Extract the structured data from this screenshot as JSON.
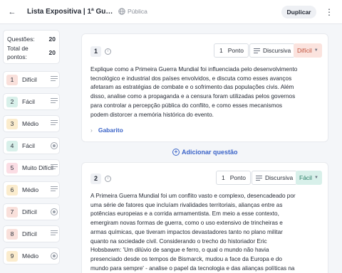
{
  "header": {
    "title": "Lista Expositiva | 1ª Guerra ...",
    "visibility": "Pública",
    "duplicate_label": "Duplicar"
  },
  "summary": {
    "questions_label": "Questões:",
    "questions_value": "20",
    "points_label": "Total de pontos:",
    "points_value": "20"
  },
  "sidebar": {
    "items": [
      {
        "num": "1",
        "difficulty": "Difícil",
        "icon": "lines-icon",
        "color": "#f9e0db"
      },
      {
        "num": "2",
        "difficulty": "Fácil",
        "icon": "lines-icon",
        "color": "#d8f0ea"
      },
      {
        "num": "3",
        "difficulty": "Médio",
        "icon": "lines-icon",
        "color": "#fbeccd"
      },
      {
        "num": "4",
        "difficulty": "Fácil",
        "icon": "radio-icon",
        "color": "#d8f0ea"
      },
      {
        "num": "5",
        "difficulty": "Muito Difícil",
        "icon": "lines-icon",
        "color": "#fbdde4"
      },
      {
        "num": "6",
        "difficulty": "Médio",
        "icon": "lines-icon",
        "color": "#fbeccd"
      },
      {
        "num": "7",
        "difficulty": "Difícil",
        "icon": "radio-icon",
        "color": "#f9e0db"
      },
      {
        "num": "8",
        "difficulty": "Difícil",
        "icon": "lines-icon",
        "color": "#f9e0db"
      },
      {
        "num": "9",
        "difficulty": "Médio",
        "icon": "radio-icon",
        "color": "#fbeccd"
      }
    ]
  },
  "questions": [
    {
      "num": "1",
      "points": "1",
      "points_label": "Ponto",
      "type": "Discursiva",
      "difficulty": "Difícil",
      "difficulty_color": "#fbe3de",
      "difficulty_text_color": "#c0503a",
      "text": "Explique como a Primeira Guerra Mundial foi influenciada pelo desenvolvimento tecnológico e industrial dos países envolvidos, e discuta como esses avanços afetaram as estratégias de combate e o sofrimento das populações civis. Além disso, analise como a propaganda e a censura foram utilizadas pelos governos para controlar a percepção pública do conflito, e como esses mecanismos podem distorcer a memória histórica do evento.",
      "gabarito": "Gabarito"
    },
    {
      "num": "2",
      "points": "1",
      "points_label": "Ponto",
      "type": "Discursiva",
      "difficulty": "Fácil",
      "difficulty_color": "#d8f0ea",
      "difficulty_text_color": "#2a7d66",
      "text": "A Primeira Guerra Mundial foi um conflito vasto e complexo, desencadeado por uma série de fatores que incluíam rivalidades territoriais, alianças entre as potências europeias e a corrida armamentista. Em meio a esse contexto, emergiram novas formas de guerra, como o uso extensivo de trincheiras e armas químicas, que tiveram impactos devastadores tanto no plano militar quanto na sociedade civil. Considerando o trecho do historiador Eric Hobsbawm: 'Um dilúvio de sangue e ferro, o qual o mundo não havia presenciado desde os tempos de Bismarck, mudou a face da Europa e do mundo para sempre' - analise o papel da tecnologia e das alianças políticas na eclosão e no desenvolvimento da Primeira Guerra Mundial. Considere o"
    }
  ],
  "add_question_label": "Adicionar questão"
}
